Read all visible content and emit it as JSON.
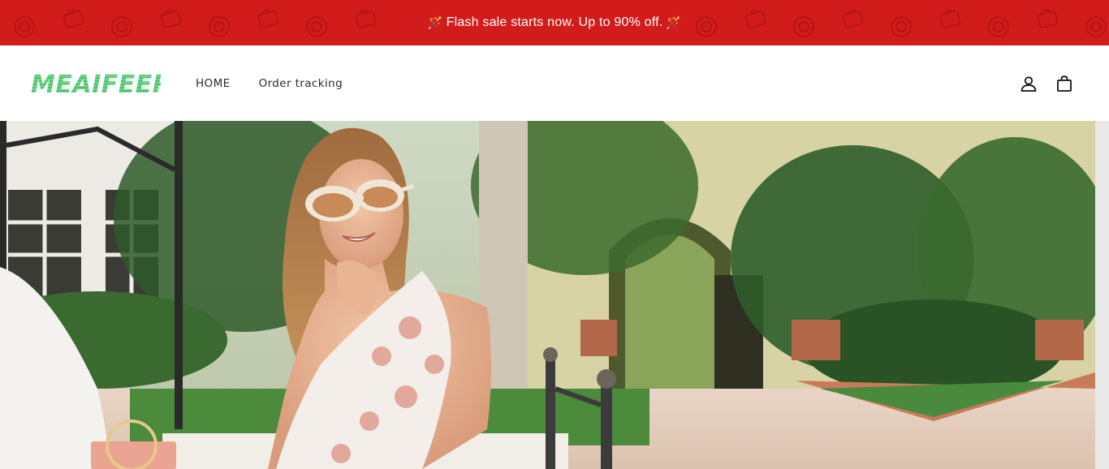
{
  "announcement": {
    "left_emoji": "🪄",
    "text": "Flash sale starts now. Up to 90% off.",
    "right_emoji": "🪄",
    "background": "#d21c1c"
  },
  "header": {
    "logo_text": "MEAIFEER",
    "logo_color": "#4cc46b",
    "nav": [
      {
        "label": "HOME"
      },
      {
        "label": "Order tracking"
      }
    ],
    "icons": [
      "account-icon",
      "cart-icon"
    ]
  },
  "hero": {
    "image_description": "woman-in-sunglasses-garden-photo"
  }
}
